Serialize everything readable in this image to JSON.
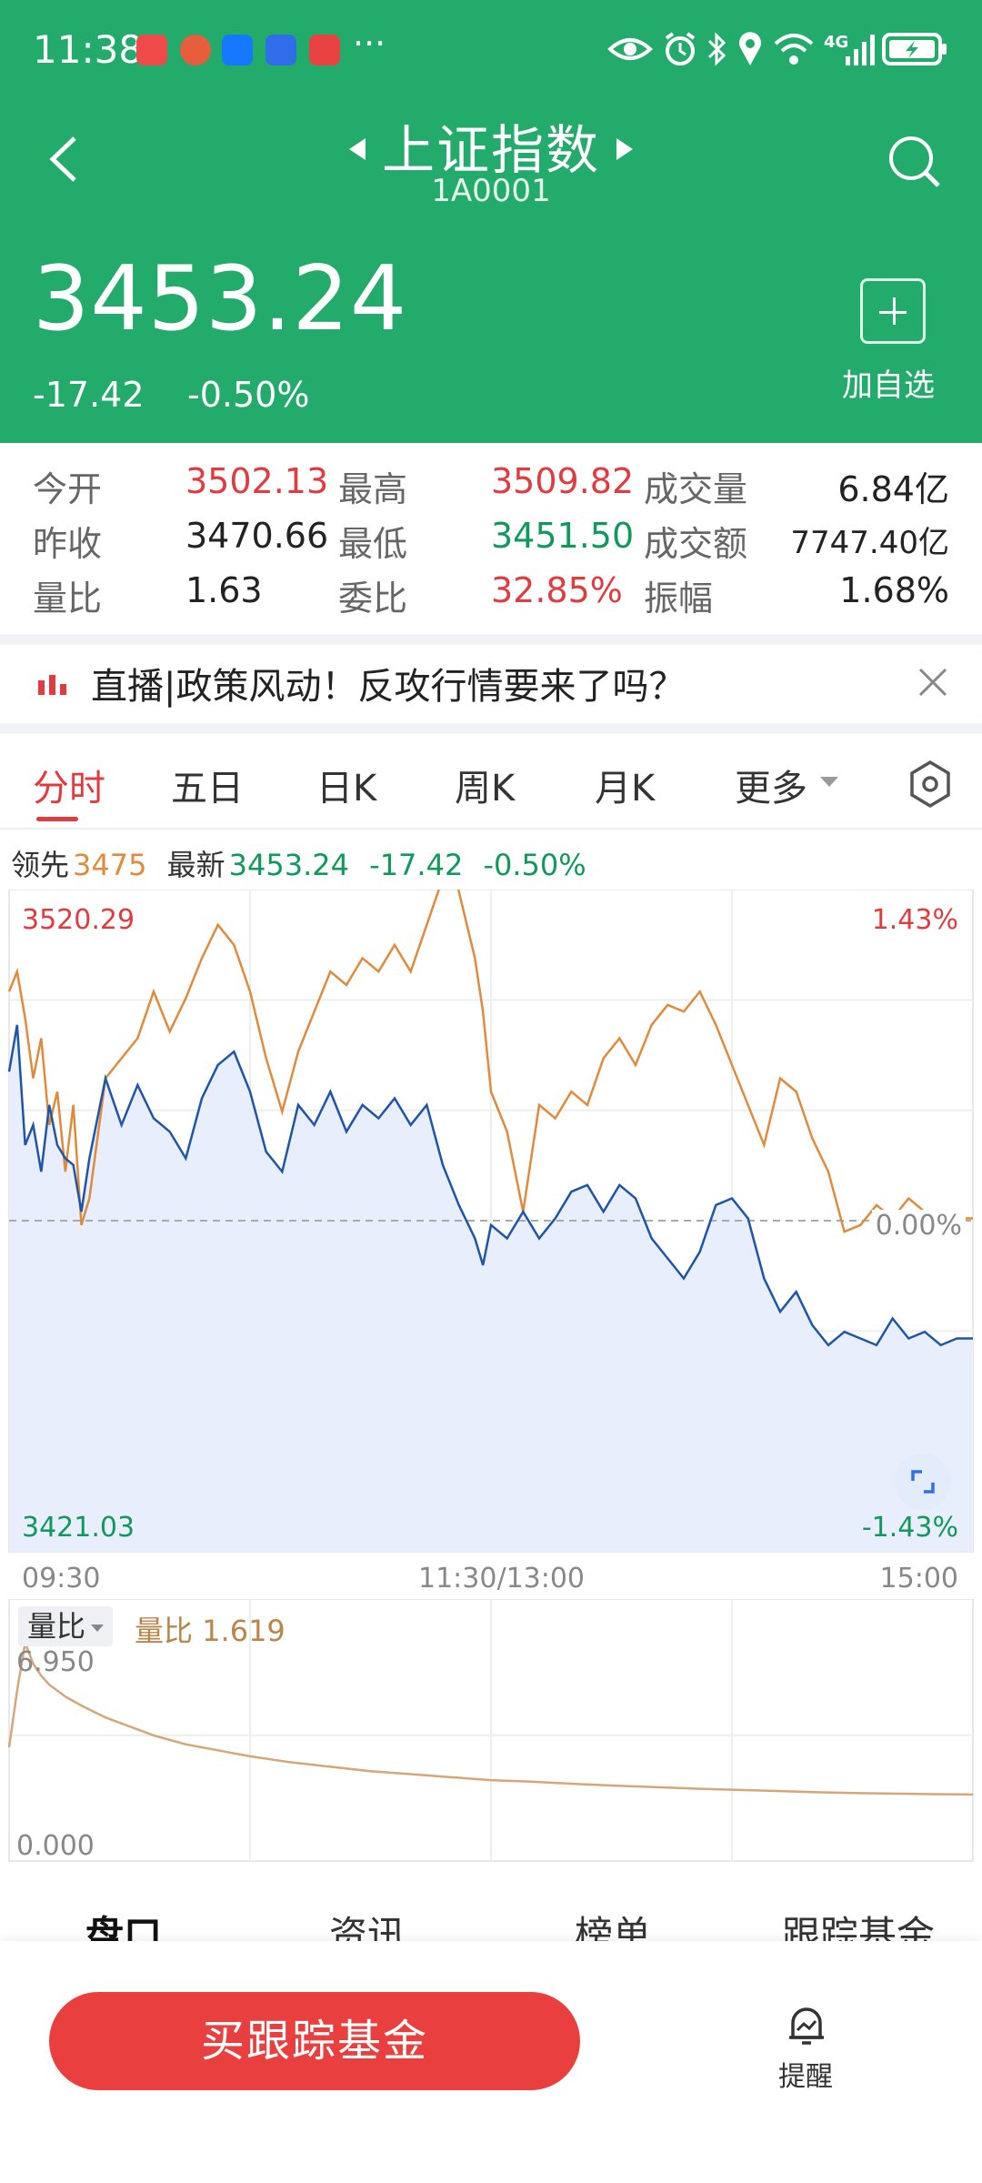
{
  "status_bar": {
    "time": "11:38",
    "more": "···",
    "network": "4G"
  },
  "header": {
    "title": "上证指数",
    "code": "1A0001",
    "price": "3453.24",
    "change": "-17.42",
    "change_pct": "-0.50%",
    "add_watchlist": "加自选"
  },
  "stats": {
    "rows": [
      [
        {
          "label": "今开",
          "value": "3502.13",
          "color": "red"
        },
        {
          "label": "最高",
          "value": "3509.82",
          "color": "red"
        },
        {
          "label": "成交量",
          "value": "6.84亿",
          "color": "dark"
        }
      ],
      [
        {
          "label": "昨收",
          "value": "3470.66",
          "color": "dark"
        },
        {
          "label": "最低",
          "value": "3451.50",
          "color": "green"
        },
        {
          "label": "成交额",
          "value": "7747.40亿",
          "color": "dark"
        }
      ],
      [
        {
          "label": "量比",
          "value": "1.63",
          "color": "dark"
        },
        {
          "label": "委比",
          "value": "32.85%",
          "color": "red"
        },
        {
          "label": "振幅",
          "value": "1.68%",
          "color": "dark"
        }
      ]
    ]
  },
  "banner": {
    "text": "直播|政策风动！反攻行情要来了吗？"
  },
  "tabs": [
    "分时",
    "五日",
    "日K",
    "周K",
    "月K",
    "更多"
  ],
  "legend": {
    "lead_label": "领先",
    "lead_value": "3475",
    "latest_label": "最新",
    "latest_value": "3453.24",
    "latest_change": "-17.42",
    "latest_pct": "-0.50%"
  },
  "chart_data": [
    {
      "type": "line",
      "y_max_label": "3520.29",
      "y_min_label": "3421.03",
      "right_top_label": "1.43%",
      "right_mid_label": "0.00%",
      "right_bottom_label": "-1.43%",
      "ylim": [
        3421.03,
        3520.29
      ],
      "baseline": 3470.66,
      "x_ticks": [
        "09:30",
        "11:30/13:00",
        "15:00"
      ],
      "total_minutes": 240,
      "colors": {
        "lead": "#e08a3c",
        "latest": "#1f55a8",
        "fill": "#e8eefc"
      },
      "series": [
        {
          "name": "领先",
          "x": [
            0,
            2,
            4,
            6,
            8,
            10,
            12,
            14,
            16,
            18,
            20,
            24,
            28,
            32,
            36,
            40,
            44,
            48,
            52,
            56,
            60,
            64,
            68,
            72,
            76,
            80,
            84,
            88,
            92,
            96,
            100,
            104,
            108,
            110,
            112,
            116,
            118,
            120,
            124,
            128,
            132,
            136,
            140,
            144,
            148,
            152,
            156,
            160,
            164,
            168,
            172,
            176,
            180,
            184,
            188,
            192,
            196,
            200,
            204,
            208,
            212,
            216,
            220,
            224,
            228,
            232,
            236,
            240
          ],
          "values": [
            3505,
            3508,
            3501,
            3492,
            3498,
            3485,
            3490,
            3478,
            3488,
            3470,
            3474,
            3492,
            3495,
            3498,
            3505,
            3499,
            3504,
            3510,
            3515,
            3512,
            3505,
            3495,
            3487,
            3496,
            3502,
            3508,
            3506,
            3510,
            3508,
            3512,
            3508,
            3515,
            3522,
            3525,
            3520,
            3510,
            3502,
            3490,
            3484,
            3472,
            3488,
            3486,
            3490,
            3488,
            3495,
            3498,
            3494,
            3500,
            3503,
            3502,
            3505,
            3500,
            3494,
            3488,
            3482,
            3492,
            3490,
            3483,
            3478,
            3469,
            3470,
            3473,
            3471,
            3474,
            3472,
            3470,
            3471,
            3471
          ]
        },
        {
          "name": "最新",
          "x": [
            0,
            2,
            4,
            6,
            8,
            10,
            12,
            14,
            16,
            18,
            20,
            24,
            28,
            32,
            36,
            40,
            44,
            48,
            52,
            56,
            60,
            64,
            68,
            72,
            76,
            80,
            84,
            88,
            92,
            96,
            100,
            104,
            108,
            110,
            112,
            116,
            118,
            120,
            124,
            128,
            132,
            136,
            140,
            144,
            148,
            152,
            156,
            160,
            164,
            168,
            172,
            176,
            180,
            184,
            188,
            192,
            196,
            200,
            204,
            208,
            212,
            216,
            220,
            224,
            228,
            232,
            236,
            240
          ],
          "values": [
            3493,
            3500,
            3482,
            3485,
            3478,
            3488,
            3482,
            3480,
            3479,
            3472,
            3480,
            3492,
            3485,
            3491,
            3486,
            3484,
            3480,
            3489,
            3494,
            3496,
            3490,
            3481,
            3478,
            3488,
            3485,
            3490,
            3484,
            3488,
            3486,
            3489,
            3485,
            3488,
            3479,
            3476,
            3473,
            3468,
            3464,
            3470,
            3468,
            3472,
            3468,
            3471,
            3475,
            3476,
            3472,
            3476,
            3474,
            3468,
            3465,
            3462,
            3466,
            3473,
            3474,
            3471,
            3462,
            3457,
            3460,
            3455,
            3452,
            3454,
            3453,
            3452,
            3456,
            3453,
            3454,
            3452,
            3453,
            3453
          ]
        }
      ]
    },
    {
      "type": "line",
      "selector_label": "量比",
      "value_label": "量比 1.619",
      "y_max_label": "6.950",
      "y_min_label": "0.000",
      "ylim": [
        0,
        6.95
      ],
      "colors": {
        "line": "#d4a679"
      },
      "series": [
        {
          "name": "量比",
          "x": [
            0,
            2,
            4,
            6,
            8,
            10,
            14,
            18,
            24,
            30,
            36,
            44,
            52,
            60,
            70,
            80,
            90,
            100,
            110,
            120,
            130,
            140,
            150,
            160,
            170,
            180,
            190,
            200,
            210,
            220,
            230,
            240
          ],
          "values": [
            3.2,
            5.1,
            6.7,
            6.0,
            5.6,
            5.3,
            4.9,
            4.6,
            4.2,
            3.9,
            3.6,
            3.3,
            3.1,
            2.9,
            2.7,
            2.55,
            2.4,
            2.3,
            2.2,
            2.1,
            2.05,
            1.98,
            1.92,
            1.87,
            1.82,
            1.78,
            1.74,
            1.7,
            1.67,
            1.65,
            1.63,
            1.62
          ]
        }
      ]
    }
  ],
  "bottom_tabs": [
    "盘口",
    "资讯",
    "榜单",
    "跟踪基金"
  ],
  "actions": {
    "buy": "买跟踪基金",
    "remind": "提醒"
  }
}
